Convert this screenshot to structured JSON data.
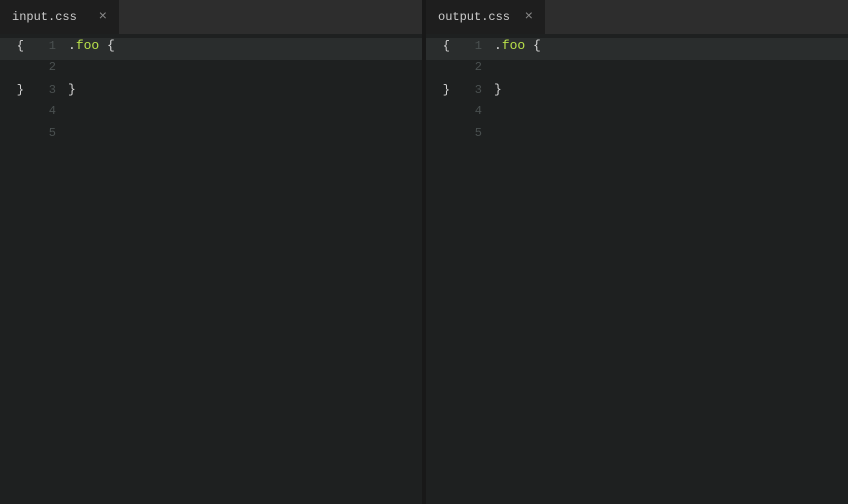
{
  "panes": [
    {
      "id": "left",
      "tab": {
        "label": "input.css",
        "close_icon": "×"
      },
      "lines": [
        {
          "number": "1",
          "tokens": [
            {
              "type": "brace",
              "text": "{"
            },
            {
              "type": "number",
              "text": "1"
            },
            {
              "type": "space",
              "text": "  "
            },
            {
              "type": "dot",
              "text": "."
            },
            {
              "type": "class",
              "text": "foo"
            },
            {
              "type": "space",
              "text": " "
            },
            {
              "type": "open-brace",
              "text": "{"
            }
          ]
        },
        {
          "number": "2",
          "tokens": []
        },
        {
          "number": "3",
          "tokens": [
            {
              "type": "brace",
              "text": "}"
            },
            {
              "type": "number",
              "text": "3"
            },
            {
              "type": "space",
              "text": "  "
            },
            {
              "type": "close-brace",
              "text": "}"
            }
          ]
        },
        {
          "number": "4",
          "tokens": []
        },
        {
          "number": "5",
          "tokens": []
        }
      ],
      "code": [
        {
          "num": "1",
          "content_raw": ".foo {",
          "line_num_display": "1"
        },
        {
          "num": "2",
          "content_raw": "",
          "line_num_display": "2"
        },
        {
          "num": "3",
          "content_raw": "}",
          "line_num_display": "3"
        },
        {
          "num": "4",
          "content_raw": "",
          "line_num_display": "4"
        },
        {
          "num": "5",
          "content_raw": "",
          "line_num_display": "5"
        }
      ]
    },
    {
      "id": "right",
      "tab": {
        "label": "output.css",
        "close_icon": "×"
      },
      "code": [
        {
          "num": "1",
          "content_raw": ".foo {",
          "line_num_display": "1"
        },
        {
          "num": "2",
          "content_raw": "",
          "line_num_display": "2"
        },
        {
          "num": "3",
          "content_raw": "}",
          "line_num_display": "3"
        },
        {
          "num": "4",
          "content_raw": "",
          "line_num_display": "4"
        },
        {
          "num": "5",
          "content_raw": "",
          "line_num_display": "5"
        }
      ]
    }
  ],
  "colors": {
    "bg": "#1e2020",
    "tab_bg": "#1e1e1e",
    "tab_bar_bg": "#2d2d2d",
    "line_number": "#4a5050",
    "text": "#d4d4d4",
    "class_name": "#b8e04a",
    "dot": "#d4d4d4",
    "brace": "#d4d4d4",
    "line_num_brace": "#d4d4d4",
    "divider": "#181818"
  }
}
